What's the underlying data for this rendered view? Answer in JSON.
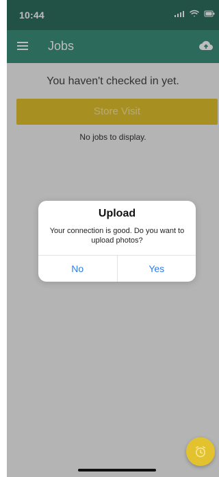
{
  "status_bar": {
    "time": "10:44",
    "icons": [
      "location-arrow-icon",
      "signal-icon",
      "wifi-icon",
      "battery-icon"
    ]
  },
  "app_bar": {
    "title": "Jobs",
    "menu_icon": "hamburger-menu-icon",
    "action_icon": "cloud-upload-icon"
  },
  "main": {
    "checkin_message": "You haven't checked in yet.",
    "store_visit_label": "Store Visit",
    "no_jobs_message": "No jobs to display."
  },
  "dialog": {
    "title": "Upload",
    "message": "Your connection is good. Do you want to upload photos?",
    "no_label": "No",
    "yes_label": "Yes"
  },
  "fab": {
    "icon": "alarm-clock-icon"
  },
  "colors": {
    "status_bar": "#2f6e5f",
    "app_bar": "#3c8f7d",
    "accent_yellow": "#e3c22f",
    "link_blue": "#2b7de9"
  }
}
